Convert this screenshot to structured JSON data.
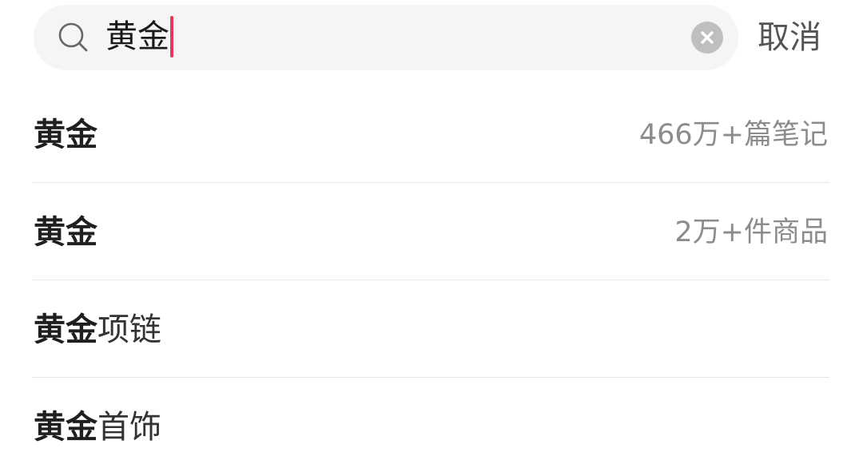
{
  "search": {
    "query": "黄金",
    "icon": "search-icon",
    "clear_icon": "clear-icon",
    "cancel_label": "取消",
    "caret_color": "#e8375a"
  },
  "suggestions": [
    {
      "highlight": "黄金",
      "rest": "",
      "meta": "466万+篇笔记"
    },
    {
      "highlight": "黄金",
      "rest": "",
      "meta": "2万+件商品"
    },
    {
      "highlight": "黄金",
      "rest": "项链",
      "meta": ""
    },
    {
      "highlight": "黄金",
      "rest": "首饰",
      "meta": ""
    }
  ]
}
